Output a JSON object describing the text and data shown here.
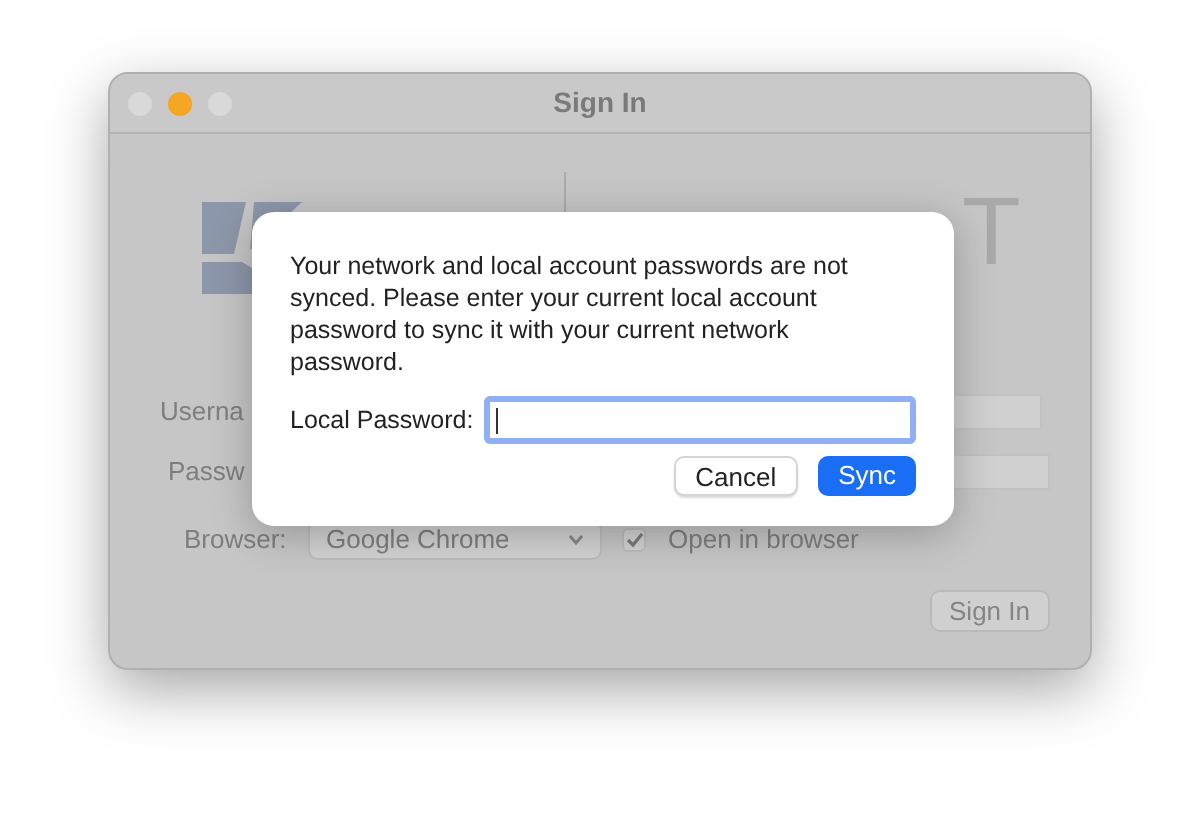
{
  "window": {
    "title": "Sign In",
    "controls": [
      {
        "color": "#d9d9d9"
      },
      {
        "color": "#f5a623"
      },
      {
        "color": "#d9d9d9"
      }
    ]
  },
  "logo_text": "T",
  "form": {
    "rows": [
      {
        "kind": "text",
        "label": "Userna"
      },
      {
        "kind": "text",
        "label": "Passw"
      },
      {
        "kind": "select",
        "label": "Browser:",
        "value": "Google Chrome"
      }
    ],
    "checkbox": {
      "label": "Open in browser",
      "checked": true
    },
    "button": "Sign In"
  },
  "dialog": {
    "message": "Your network and local account passwords are not synced. Please enter your current local account password to sync it with your current network password.",
    "field_label": "Local Password:",
    "focused": true,
    "buttons": [
      {
        "label": "Cancel",
        "primary": false
      },
      {
        "label": "Sync",
        "primary": true
      }
    ]
  }
}
